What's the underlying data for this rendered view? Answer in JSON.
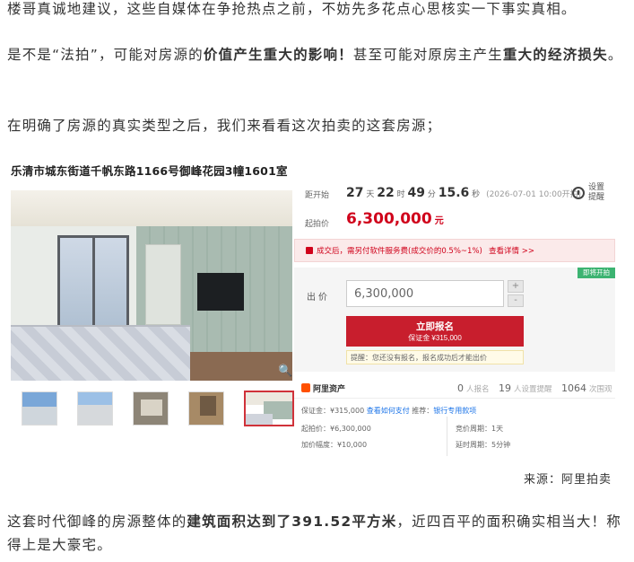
{
  "paragraphs": {
    "p1": "楼哥真诚地建议，这些自媒体在争抢热点之前，不妨先多花点心思核实一下事实真相。",
    "p2_a": "是不是“法拍”，可能对房源的",
    "p2_b": "价值产生重大的影响！",
    "p2_c": "甚至可能对原房主产生",
    "p2_d": "重大的经济损失",
    "p2_e": "。",
    "p3": "在明确了房源的真实类型之后，我们来看看这次拍卖的这套房源；",
    "p4_a": "这套时代御峰的房源整体的",
    "p4_b": "建筑面积达到了391.52平方米",
    "p4_c": "，近四百平的面积确实相当大！称得上是大豪宅。"
  },
  "listing": {
    "address": "乐清市城东街道千帆东路1166号御峰花园3幢1601室",
    "countdown_label": "距开始",
    "countdown": {
      "days": "27",
      "days_unit": "天",
      "hours": "22",
      "hours_unit": "时",
      "minutes": "49",
      "minutes_unit": "分",
      "seconds": "15.6",
      "seconds_unit": "秒",
      "open_time": "(2026-07-01 10:00开拍)"
    },
    "remind_label": "设置提醒",
    "start_price_label": "起拍价",
    "start_price": "6,300,000",
    "start_price_unit": "元",
    "notice_text": "成交后，需另付软件服务费(成交价的0.5%~1%)",
    "notice_link": "查看详情 >>",
    "tag": "即将开拍",
    "bid_label": "出价",
    "bid_value": "6,300,000",
    "step_up": "+",
    "step_down": "-",
    "register_button": "立即报名",
    "deposit_line": "保证金 ¥315,000",
    "tip": "提醒：您还没有报名，报名成功后才能出价",
    "platform": "阿里资产",
    "stats": [
      {
        "value": "0",
        "label": "人报名"
      },
      {
        "value": "19",
        "label": "人设置提醒"
      },
      {
        "value": "1064",
        "label": "次围观"
      }
    ],
    "details": {
      "deposit": "保证金：¥315,000",
      "deposit_link": "查看如何支付",
      "recommend_label": "推荐：",
      "recommend_link": "银行专用款项",
      "start_price": "起拍价：¥6,300,000",
      "increment": "加价幅度：¥10,000",
      "cycle": "竞价周期：1天",
      "extension": "延时周期：5分钟"
    }
  },
  "source": "来源：阿里拍卖"
}
